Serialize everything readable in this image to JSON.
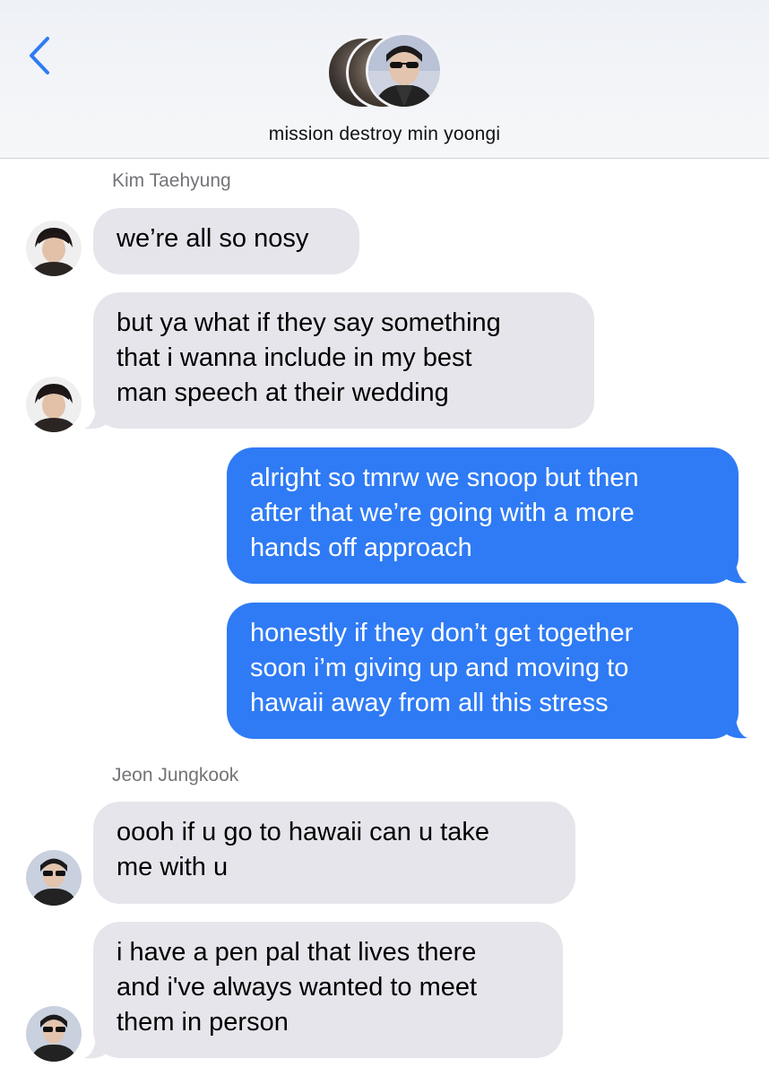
{
  "header": {
    "back_icon": "chevron-left-icon",
    "group_name": "mission destroy min yoongi",
    "accent_color": "#2f7bf5"
  },
  "messages": [
    {
      "sender": "Kim Taehyung",
      "direction": "incoming",
      "lines": [
        "we’re all so nosy"
      ]
    },
    {
      "direction": "incoming",
      "lines": [
        "but ya what if they say something",
        "that i wanna include in my best",
        "man speech at their wedding"
      ]
    },
    {
      "direction": "outgoing",
      "lines": [
        "alright so tmrw we snoop but then",
        "after that we’re going with a more",
        "hands off approach"
      ]
    },
    {
      "direction": "outgoing",
      "lines": [
        "honestly if they don’t get together",
        "soon i’m giving up and moving to",
        "hawaii away from all this stress"
      ]
    },
    {
      "sender": "Jeon Jungkook",
      "direction": "incoming",
      "lines": [
        "oooh if u go to hawaii can u take",
        "me with u"
      ]
    },
    {
      "direction": "incoming",
      "lines": [
        "i have a pen pal that lives there",
        "and i've always wanted to meet",
        "them in person"
      ]
    }
  ]
}
